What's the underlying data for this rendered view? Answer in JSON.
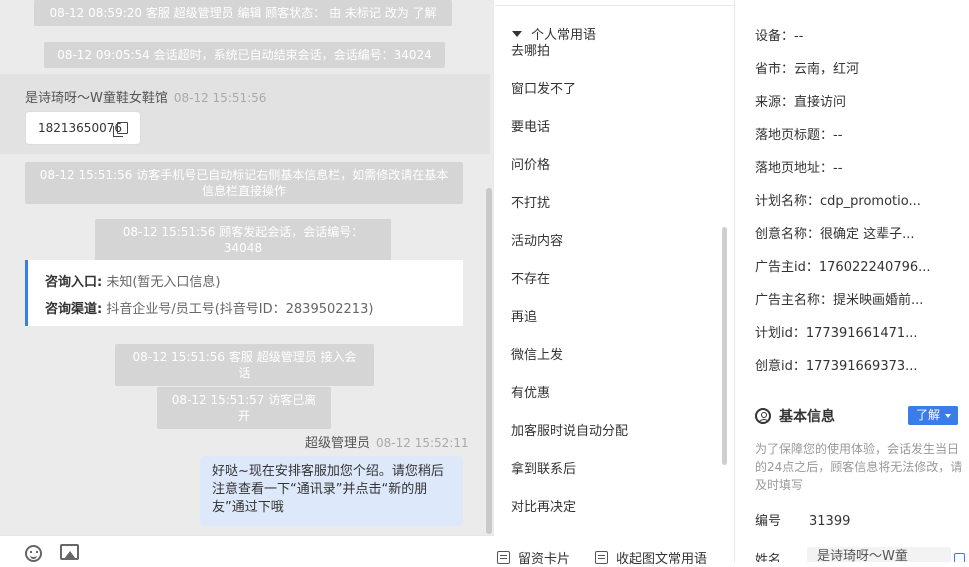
{
  "chat": {
    "sys1": "08-12 08:59:20 客服 超级管理员 编辑 顾客状态： 由 未标记 改为 了解",
    "sys2": "08-12 09:05:54 会话超时，系统已自动结束会话，会话编号：34024",
    "visitor_name": "是诗琦呀～W童鞋女鞋馆",
    "visitor_time": "08-12 15:51:56",
    "visitor_phone": "18213650076",
    "sys3": "08-12 15:51:56 访客手机号已自动标记右侧基本信息栏，如需修改请在基本信息栏直接操作",
    "sys4": "08-12 15:51:56 顾客发起会话，会话编号：34048",
    "entry_label": "咨询入口:",
    "entry_value": "未知(暂无入口信息)",
    "channel_label": "咨询渠道:",
    "channel_value": "抖音企业号/员工号(抖音号ID：2839502213)",
    "sys5": "08-12 15:51:56 客服 超级管理员 接入会话",
    "sys6": "08-12 15:51:57 访客已离开",
    "agent_name": "超级管理员",
    "agent_time": "08-12 15:52:11",
    "agent_message": "好哒~现在安排客服加您个绍。请您稍后注意查看一下“通讯录”并点击“新的朋友”通过下哦"
  },
  "phrases": {
    "group_title": "个人常用语",
    "items": [
      "去哪拍",
      "窗口发不了",
      "要电话",
      "问价格",
      "不打扰",
      "活动内容",
      "不存在",
      "再追",
      "微信上发",
      "有优惠",
      "加客服时说自动分配",
      "拿到联系后",
      "对比再决定"
    ],
    "bottom_left": "留资卡片",
    "bottom_right": "收起图文常用语"
  },
  "details": {
    "device_label": "设备：",
    "device_value": "--",
    "region_label": "省市：",
    "region_value": "云南，红河",
    "source_label": "来源：",
    "source_value": "直接访问",
    "landing_title_label": "落地页标题：",
    "landing_title_value": "--",
    "landing_url_label": "落地页地址：",
    "landing_url_value": "--",
    "plan_name_label": "计划名称：",
    "plan_name_value": "cdp_promotio...",
    "creative_name_label": "创意名称：",
    "creative_name_value": "很确定 这辈子...",
    "advertiser_id_label": "广告主id：",
    "advertiser_id_value": "176022240796...",
    "advertiser_name_label": "广告主名称：",
    "advertiser_name_value": "提米映画婚前...",
    "plan_id_label": "计划id：",
    "plan_id_value": "177391661471...",
    "creative_id_label": "创意id：",
    "creative_id_value": "177391669373..."
  },
  "basic": {
    "title": "基本信息",
    "learn_button": "了解",
    "note": "为了保障您的使用体验，会话发生当日的24点之后，顾客信息将无法修改，请及时填写",
    "number_label": "编号",
    "number_value": "31399",
    "name_label": "姓名",
    "name_value": "是诗琦呀～W童"
  }
}
